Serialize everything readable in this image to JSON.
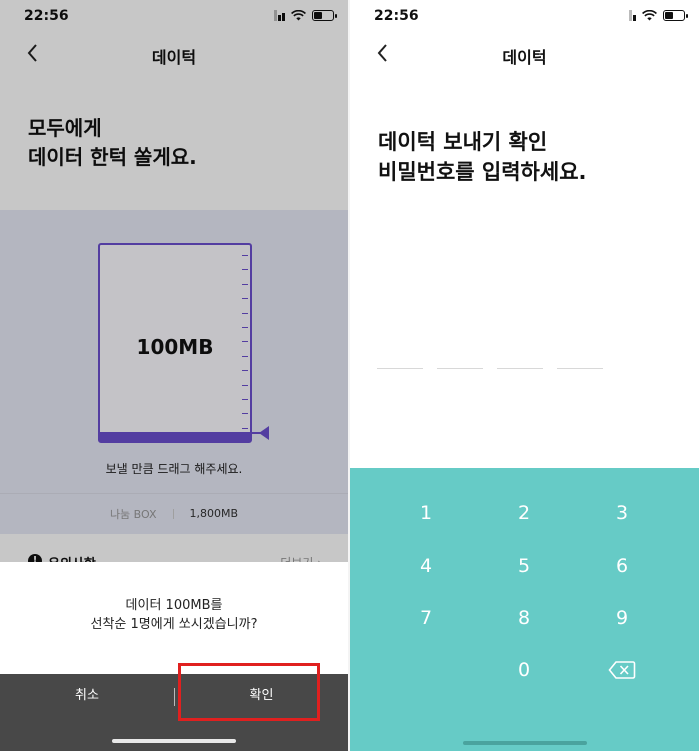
{
  "status": {
    "time": "22:56"
  },
  "left": {
    "nav": {
      "title": "데이턱"
    },
    "headline": [
      "모두에게",
      "데이터 한턱 쏠게요."
    ],
    "gauge": {
      "amount": "100MB",
      "hint": "보낼 만큼 드래그 해주세요."
    },
    "share": {
      "label": "나눔 BOX",
      "value": "1,800MB"
    },
    "notice": {
      "label": "유의사항",
      "more": "더보기"
    },
    "dialog": {
      "message": [
        "데이터 100MB를",
        "선착순 1명에게 쏘시겠습니까?"
      ],
      "cancel": "취소",
      "confirm": "확인"
    }
  },
  "right": {
    "nav": {
      "title": "데이턱"
    },
    "headline": [
      "데이턱 보내기 확인",
      "비밀번호를 입력하세요."
    ],
    "keypad": {
      "keys": [
        "1",
        "2",
        "3",
        "4",
        "5",
        "6",
        "7",
        "8",
        "9",
        "0"
      ],
      "backspace_icon": "backspace-icon",
      "color": "#66cbc6"
    }
  },
  "colors": {
    "accent": "#6b4fcf",
    "highlight": "#e0201f",
    "keypad": "#66cbc6"
  }
}
